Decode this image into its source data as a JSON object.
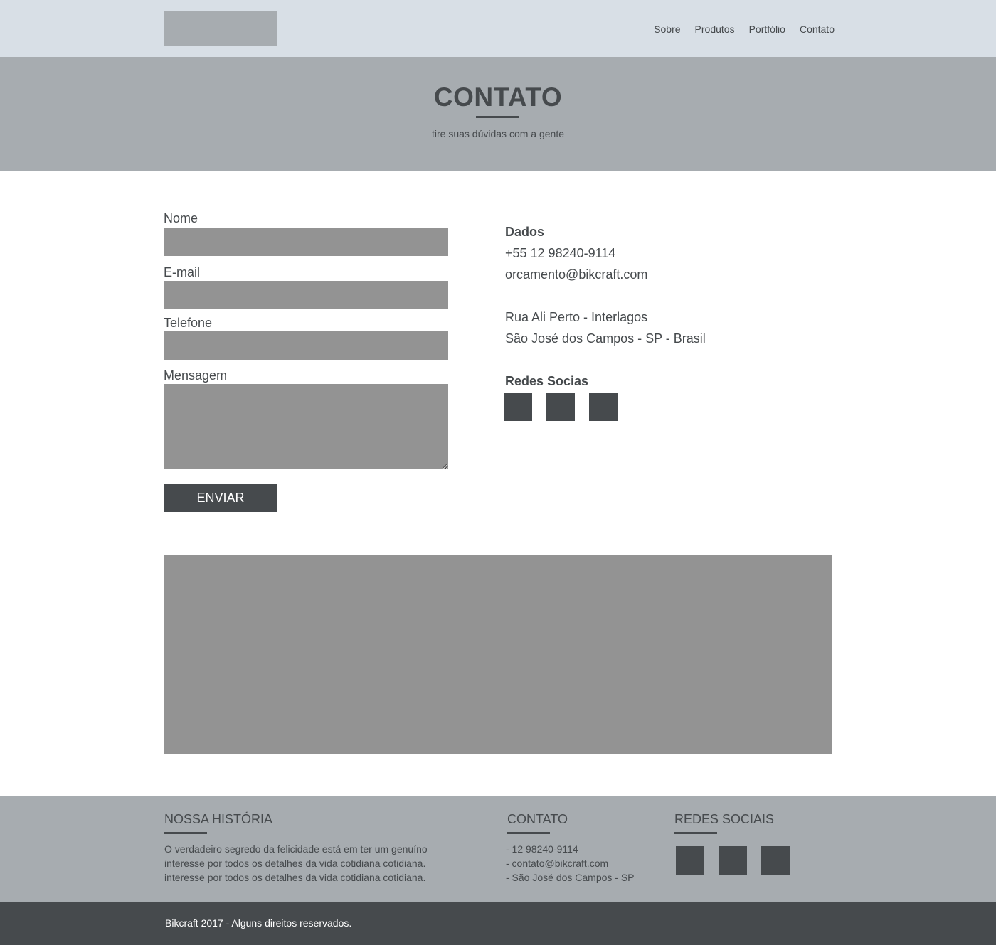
{
  "header": {
    "nav": [
      "Sobre",
      "Produtos",
      "Portfólio",
      "Contato"
    ]
  },
  "hero": {
    "title": "CONTATO",
    "subtitle": "tire suas dúvidas com a gente"
  },
  "form": {
    "name_label": "Nome",
    "email_label": "E-mail",
    "phone_label": "Telefone",
    "message_label": "Mensagem",
    "submit_label": "ENVIAR"
  },
  "contact_info": {
    "heading": "Dados",
    "phone": "+55 12 98240-9114",
    "email": "orcamento@bikcraft.com",
    "address_line1": "Rua Ali Perto - Interlagos",
    "address_line2": "São José dos Campos - SP - Brasil",
    "social_heading": "Redes Socias"
  },
  "footer": {
    "history_title": "NOSSA HISTÓRIA",
    "history_lines": [
      "O verdadeiro segredo da felicidade está em ter um genuíno",
      "interesse por todos os detalhes da vida cotidiana cotidiana.",
      "interesse por todos os detalhes da vida cotidiana cotidiana."
    ],
    "contact_title": "CONTATO",
    "contact_lines": [
      "- 12 98240-9114",
      "- contato@bikcraft.com",
      "- São José dos Campos - SP"
    ],
    "social_title": "REDES SOCIAIS",
    "copyright": "Bikcraft 2017 - Alguns direitos reservados."
  }
}
